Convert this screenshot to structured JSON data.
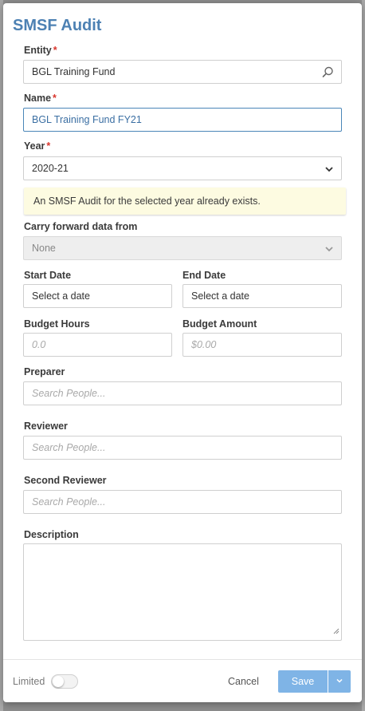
{
  "dialog": {
    "title": "SMSF Audit"
  },
  "form": {
    "entity": {
      "label": "Entity",
      "required_mark": "*",
      "value": "BGL Training Fund"
    },
    "name": {
      "label": "Name",
      "required_mark": "*",
      "value": "BGL Training Fund FY21"
    },
    "year": {
      "label": "Year",
      "required_mark": "*",
      "value": "2020-21"
    },
    "notice": "An SMSF Audit for the selected year already exists.",
    "carry_forward": {
      "label": "Carry forward data from",
      "value": "None"
    },
    "start_date": {
      "label": "Start Date",
      "value": "Select a date"
    },
    "end_date": {
      "label": "End Date",
      "value": "Select a date"
    },
    "budget_hours": {
      "label": "Budget Hours",
      "placeholder": "0.0"
    },
    "budget_amount": {
      "label": "Budget Amount",
      "placeholder": "$0.00"
    },
    "preparer": {
      "label": "Preparer",
      "placeholder": "Search People..."
    },
    "reviewer": {
      "label": "Reviewer",
      "placeholder": "Search People..."
    },
    "second_reviewer": {
      "label": "Second Reviewer",
      "placeholder": "Search People..."
    },
    "description": {
      "label": "Description",
      "value": ""
    }
  },
  "footer": {
    "limited_label": "Limited",
    "limited_on": false,
    "cancel_label": "Cancel",
    "save_label": "Save"
  },
  "colors": {
    "title": "#4d81b3",
    "required": "#d9362d",
    "focus_border": "#4a86b8",
    "notice_bg": "#fdfbe1",
    "save_button": "#7fb4e6"
  },
  "icons": {
    "entity_search": "search-icon",
    "select_arrow": "chevron-down-icon",
    "save_menu": "chevron-down-icon"
  }
}
